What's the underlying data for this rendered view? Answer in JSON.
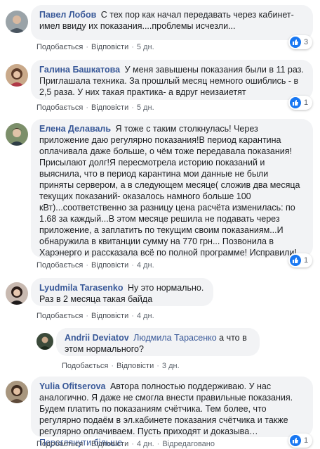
{
  "actions": {
    "like": "Подобається",
    "reply": "Відповісти",
    "edited": "Відредаговано"
  },
  "comments": [
    {
      "author": "Павел Лобов",
      "text": "С тех пор как начал передавать через кабинет- имел ввиду их показания....проблемы исчезли...",
      "time": "5 дн.",
      "reactions": "3"
    },
    {
      "author": "Галина Башкатова",
      "text": "У меня завышены показания были в 11 раз. Приглашала техника. За прошлый месяц немного ошиблись - в 2,5 раза. У них такая практика- а вдруг неизаиетят",
      "time": "5 дн.",
      "reactions": "1"
    },
    {
      "author": "Елена Делаваль",
      "text": "Я тоже с таким столкнулась! Через приложение даю регулярно показания!В период карантина оплачивала даже больше, о чём тоже передавала показания!Присылают долг!Я пересмотрела историю показаний и выяснила, что в период карантина мои данные не были приняты сервером, а в следующем месяце( сложив два месяца текущих показаний- оказалось намного больше 100 кВт)...соответственно за разницу цена расчёта изменилась: по 1.68 за каждый...В этом месяце решила не подавать через приложение, а заплатить по текущим своим показаниям...И обнаружила в квитанции сумму на 770 грн... Позвонила в Харэнерго и рассказала всё по полной программе! Исправили!",
      "time": "4 дн.",
      "reactions": "1"
    },
    {
      "author": "Lyudmila Tarasenko",
      "text": "Ну это нормально. Раз в 2 месяца такая байда",
      "time": "4 дн."
    },
    {
      "author": "Andrii Deviatov",
      "mention": "Людмила Тарасенко",
      "text": "а что в этом нормального?",
      "time": "3 дн."
    },
    {
      "author": "Yulia Ofitserova",
      "text": "Автора полностью поддерживаю. У нас аналогично. Я даже не смогла внести правильные показания. Будем платить по показаниям счётчика. Тем более, что регулярно подаём в эл.кабинете показания счётчика и также регулярно оплачиваем. Пусть приходят и доказыва…",
      "more": "Переглянути більше",
      "time": "4 дн.",
      "reactions": "1"
    }
  ]
}
